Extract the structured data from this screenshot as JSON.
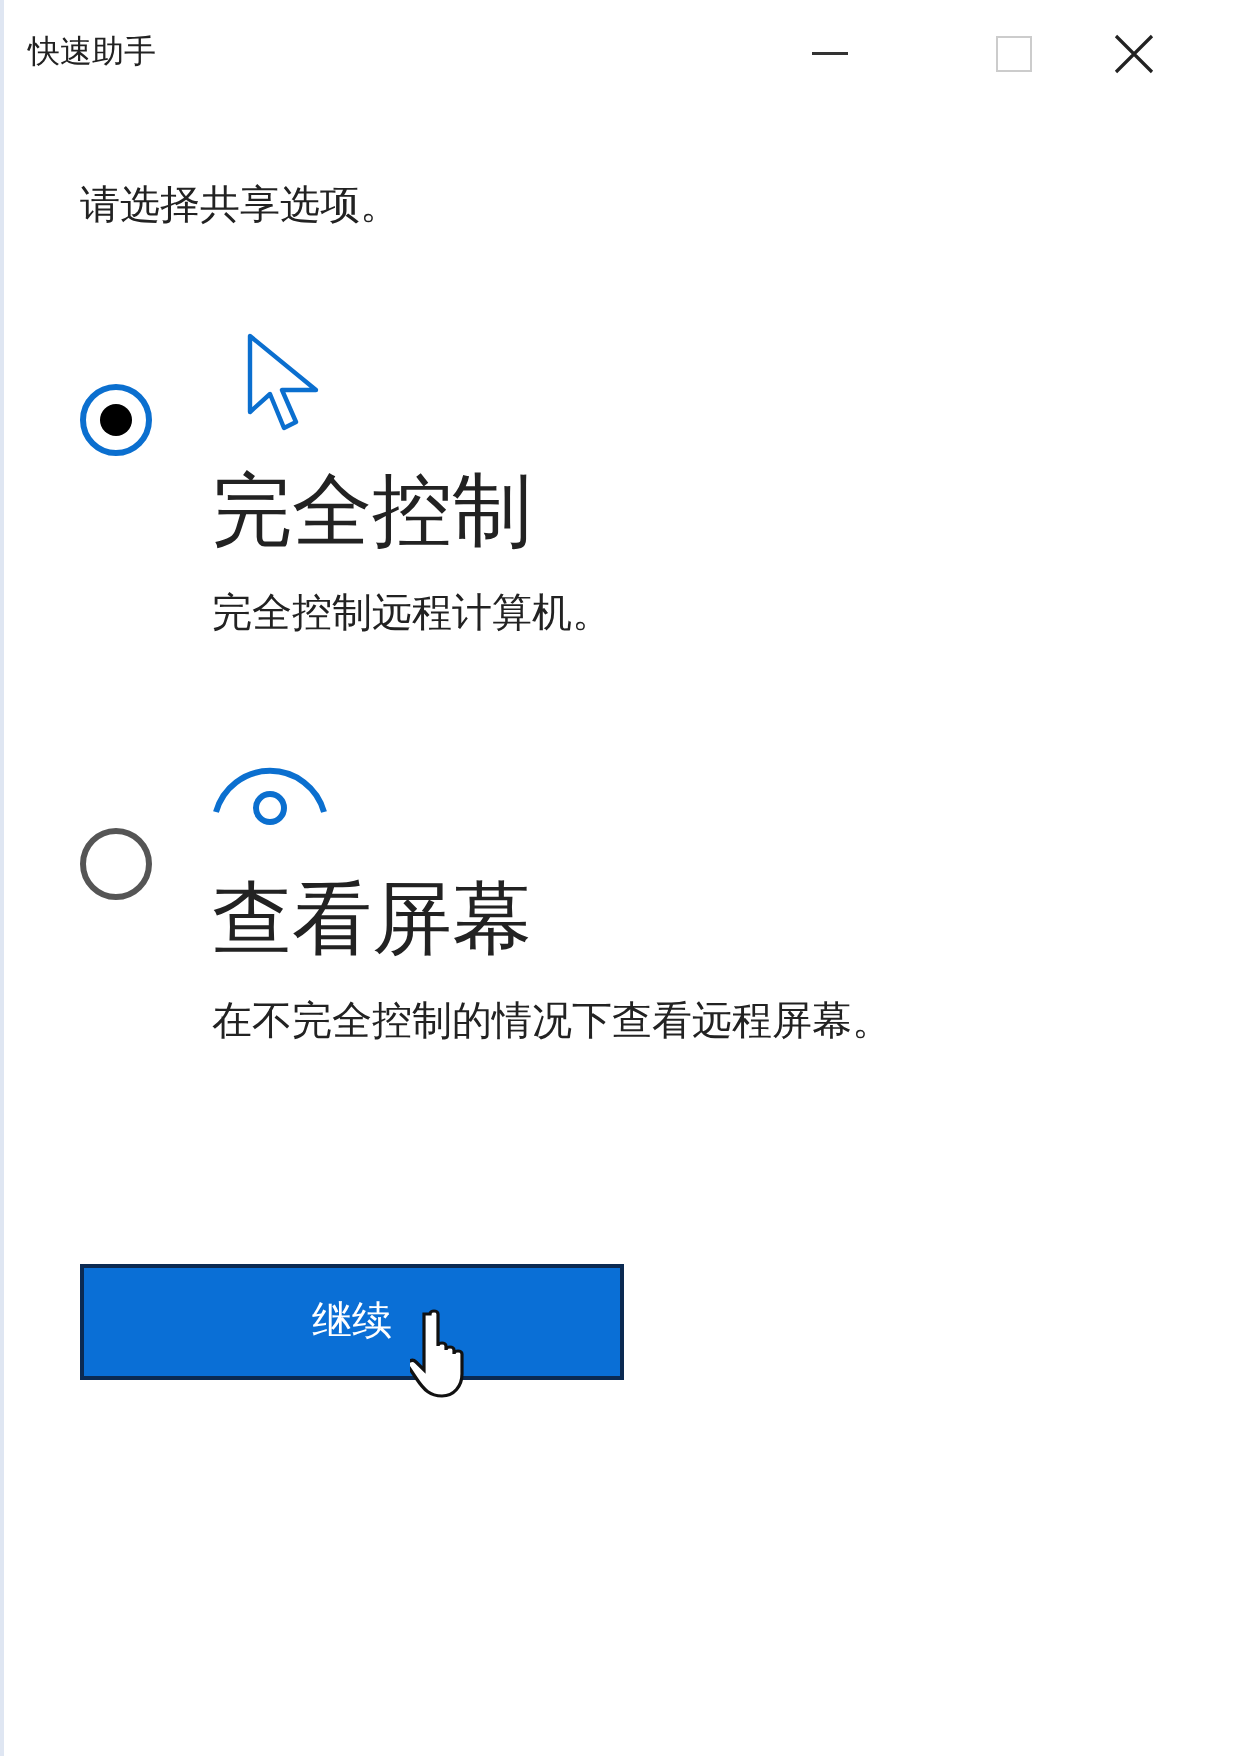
{
  "window": {
    "title": "快速助手"
  },
  "prompt": "请选择共享选项。",
  "options": [
    {
      "kind": "control",
      "title": "完全控制",
      "description": "完全控制远程计算机。",
      "selected": true
    },
    {
      "kind": "view",
      "title": "查看屏幕",
      "description": "在不完全控制的情况下查看远程屏幕。",
      "selected": false
    }
  ],
  "continue_button": "继续"
}
